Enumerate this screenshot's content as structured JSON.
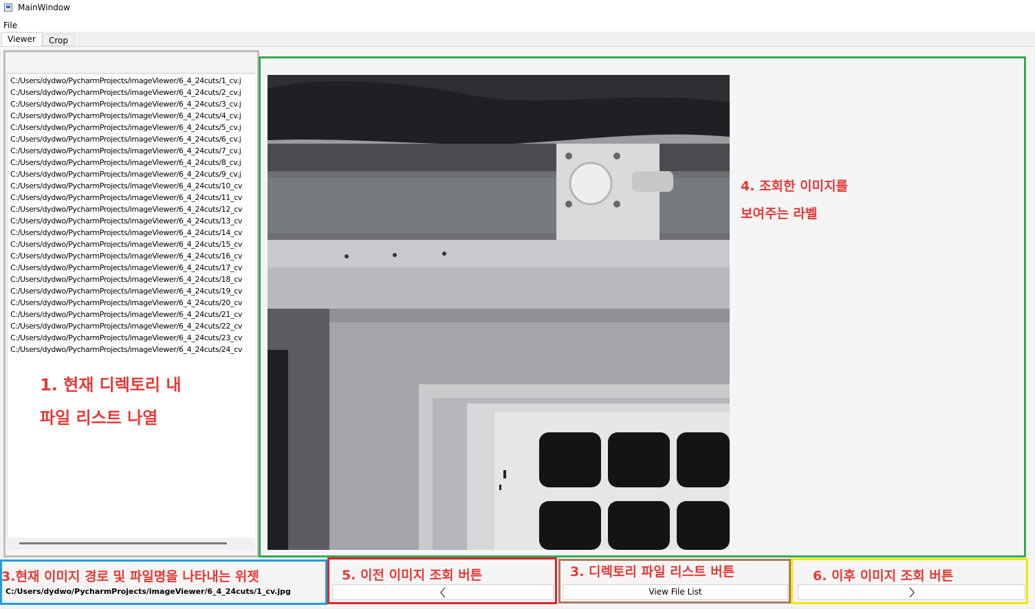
{
  "window": {
    "title": "MainWindow"
  },
  "menu": {
    "file": "File"
  },
  "tabs": [
    {
      "label": "Viewer"
    },
    {
      "label": "Crop"
    }
  ],
  "file_list": [
    "C:/Users/dydwo/PycharmProjects/imageViewer/6_4_24cuts/1_cv.j",
    "C:/Users/dydwo/PycharmProjects/imageViewer/6_4_24cuts/2_cv.j",
    "C:/Users/dydwo/PycharmProjects/imageViewer/6_4_24cuts/3_cv.j",
    "C:/Users/dydwo/PycharmProjects/imageViewer/6_4_24cuts/4_cv.j",
    "C:/Users/dydwo/PycharmProjects/imageViewer/6_4_24cuts/5_cv.j",
    "C:/Users/dydwo/PycharmProjects/imageViewer/6_4_24cuts/6_cv.j",
    "C:/Users/dydwo/PycharmProjects/imageViewer/6_4_24cuts/7_cv.j",
    "C:/Users/dydwo/PycharmProjects/imageViewer/6_4_24cuts/8_cv.j",
    "C:/Users/dydwo/PycharmProjects/imageViewer/6_4_24cuts/9_cv.j",
    "C:/Users/dydwo/PycharmProjects/imageViewer/6_4_24cuts/10_cv",
    "C:/Users/dydwo/PycharmProjects/imageViewer/6_4_24cuts/11_cv",
    "C:/Users/dydwo/PycharmProjects/imageViewer/6_4_24cuts/12_cv",
    "C:/Users/dydwo/PycharmProjects/imageViewer/6_4_24cuts/13_cv",
    "C:/Users/dydwo/PycharmProjects/imageViewer/6_4_24cuts/14_cv",
    "C:/Users/dydwo/PycharmProjects/imageViewer/6_4_24cuts/15_cv",
    "C:/Users/dydwo/PycharmProjects/imageViewer/6_4_24cuts/16_cv",
    "C:/Users/dydwo/PycharmProjects/imageViewer/6_4_24cuts/17_cv",
    "C:/Users/dydwo/PycharmProjects/imageViewer/6_4_24cuts/18_cv",
    "C:/Users/dydwo/PycharmProjects/imageViewer/6_4_24cuts/19_cv",
    "C:/Users/dydwo/PycharmProjects/imageViewer/6_4_24cuts/20_cv",
    "C:/Users/dydwo/PycharmProjects/imageViewer/6_4_24cuts/21_cv",
    "C:/Users/dydwo/PycharmProjects/imageViewer/6_4_24cuts/22_cv",
    "C:/Users/dydwo/PycharmProjects/imageViewer/6_4_24cuts/23_cv",
    "C:/Users/dydwo/PycharmProjects/imageViewer/6_4_24cuts/24_cv"
  ],
  "current_path": "C:/Users/dydwo/PycharmProjects/imageViewer/6_4_24cuts/1_cv.jpg",
  "buttons": {
    "prev_icon": "chevron-left-icon",
    "view_file_list": "View File List",
    "next_icon": "chevron-right-icon"
  },
  "annotations": {
    "a1_line1": "1. 현재 디렉토리 내",
    "a1_line2": "파일 리스트 나열",
    "a2": "3.현재 이미지 경로 및 파일명을 나타내는 위젯",
    "a3": "3. 디렉토리 파일 리스트 버튼",
    "a4_line1": "4. 조회한 이미지를",
    "a4_line2": "보여주는 라벨",
    "a5": "5. 이전 이미지 조회 버튼",
    "a6": "6. 이후 이미지 조회 버튼"
  },
  "colors": {
    "list_border": "#bdbdbd",
    "viewer_border": "#34a853",
    "path_border": "#1e9be0",
    "prev_border": "#e0222b",
    "list_btn_border": "#a97b5f",
    "next_border": "#f5e600",
    "annotation_text": "#e53935"
  }
}
